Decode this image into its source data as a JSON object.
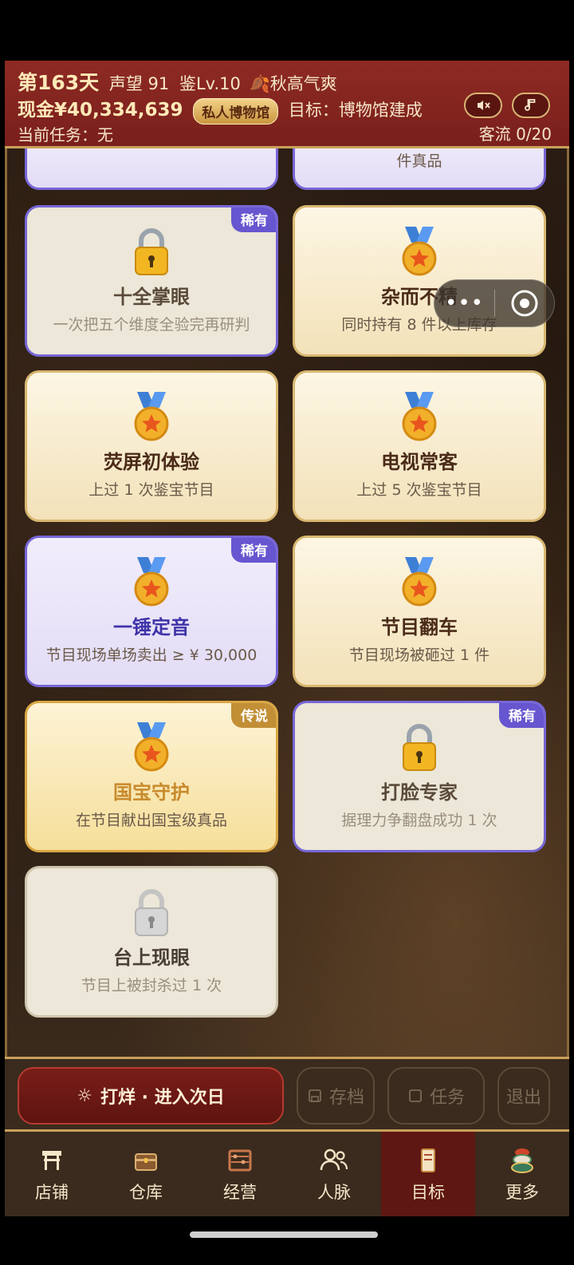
{
  "header": {
    "day": "第163天",
    "reputation": "声望 91",
    "level": "鉴Lv.10",
    "season": "秋高气爽",
    "cash": "现金¥40,334,639",
    "badge": "私人博物馆",
    "goal": "目标：博物馆建成",
    "task": "当前任务：无",
    "flow": "客流 0/20"
  },
  "cards": {
    "partial_right_desc": "件真品",
    "c1": {
      "title": "十全掌眼",
      "desc": "一次把五个维度全验完再研判",
      "badge": "稀有"
    },
    "c2": {
      "title": "杂而不精",
      "desc": "同时持有 8 件以上库存"
    },
    "c3": {
      "title": "荧屏初体验",
      "desc": "上过 1 次鉴宝节目"
    },
    "c4": {
      "title": "电视常客",
      "desc": "上过 5 次鉴宝节目"
    },
    "c5": {
      "title": "一锤定音",
      "desc": "节目现场单场卖出 ≥ ¥ 30,000",
      "badge": "稀有"
    },
    "c6": {
      "title": "节目翻车",
      "desc": "节目现场被砸过 1 件"
    },
    "c7": {
      "title": "国宝守护",
      "desc": "在节目献出国宝级真品",
      "badge": "传说"
    },
    "c8": {
      "title": "打脸专家",
      "desc": "据理力争翻盘成功 1 次",
      "badge": "稀有"
    },
    "c9": {
      "title": "台上现眼",
      "desc": "节目上被封杀过 1 次"
    }
  },
  "actions": {
    "next_day": "打烊 · 进入次日",
    "save": "存档",
    "task": "任务",
    "exit": "退出"
  },
  "nav": {
    "shop": "店铺",
    "warehouse": "仓库",
    "business": "经营",
    "contacts": "人脉",
    "goals": "目标",
    "more": "更多"
  },
  "colors": {
    "header_bg": "#7a1f1b",
    "rare": "#6656cf",
    "legend": "#c28f36",
    "active_nav": "#5e1712"
  }
}
